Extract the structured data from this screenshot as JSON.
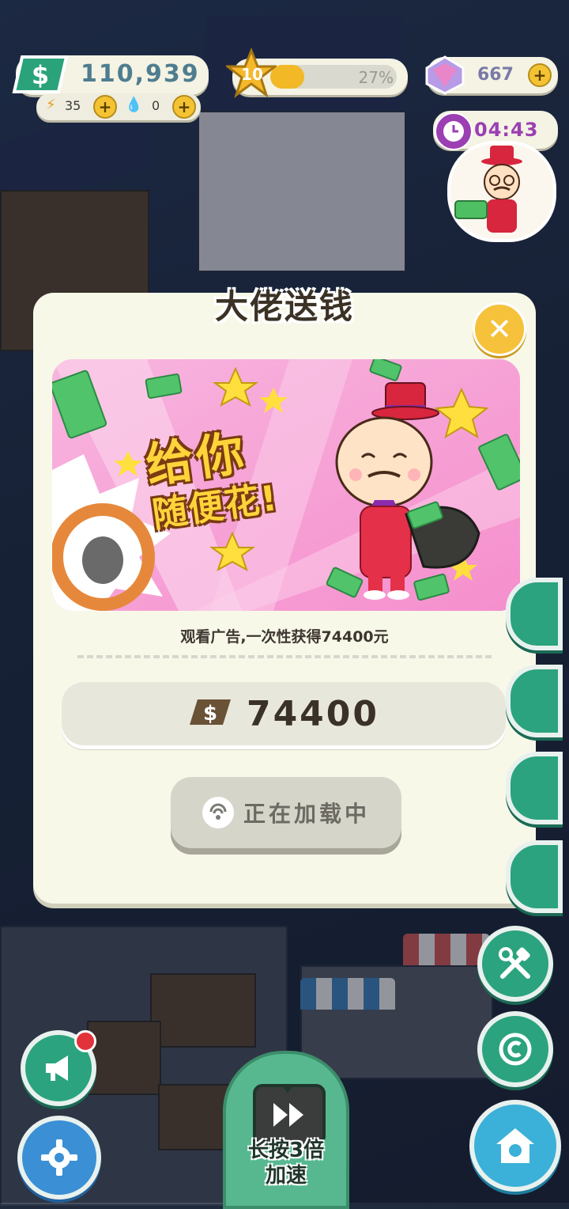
{
  "hud": {
    "cash": "110,939",
    "energy": "35",
    "water": "0",
    "level": "10",
    "level_progress_label": "27%",
    "level_progress": 0.27,
    "gems": "667",
    "timer": "04:43"
  },
  "dialog": {
    "title": "大佬送钱",
    "banner_text_line1": "给你",
    "banner_text_line2": "随便花!",
    "description": "观看广告,一次性获得74400元",
    "reward_amount": "74400",
    "loading_label": "正在加载中"
  },
  "bottom": {
    "speedup_label_line1": "长按3倍",
    "speedup_label_line2": "加速"
  },
  "colors": {
    "accent_green": "#2ba37e",
    "gold": "#f4c334",
    "dialog_bg": "#f8f8e9",
    "banner_pink": "#f7a9d9"
  }
}
